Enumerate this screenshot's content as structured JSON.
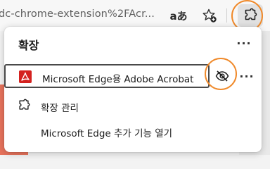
{
  "toolbar": {
    "url_fragment": "dc-chrome-extension%2FAcr...",
    "read_aloud_glyph": "aあ",
    "icons": [
      "read-aloud-icon",
      "add-favorite-icon",
      "extensions-icon"
    ]
  },
  "panel": {
    "title": "확장",
    "more_glyph": "···",
    "extension": {
      "name": "Microsoft Edge용 Adobe Acrobat",
      "icon": "adobe-acrobat-icon",
      "hide_icon": "hide-from-toolbar-icon",
      "more_glyph": "···"
    },
    "menu": [
      {
        "label": "확장 관리",
        "icon": "puzzle-icon"
      },
      {
        "label": "Microsoft Edge 추가 기능 열기",
        "icon": ""
      }
    ]
  },
  "colors": {
    "highlight_ring": "#f08a2b",
    "acrobat_red": "#d4221f",
    "page_accent": "#e8735c"
  }
}
